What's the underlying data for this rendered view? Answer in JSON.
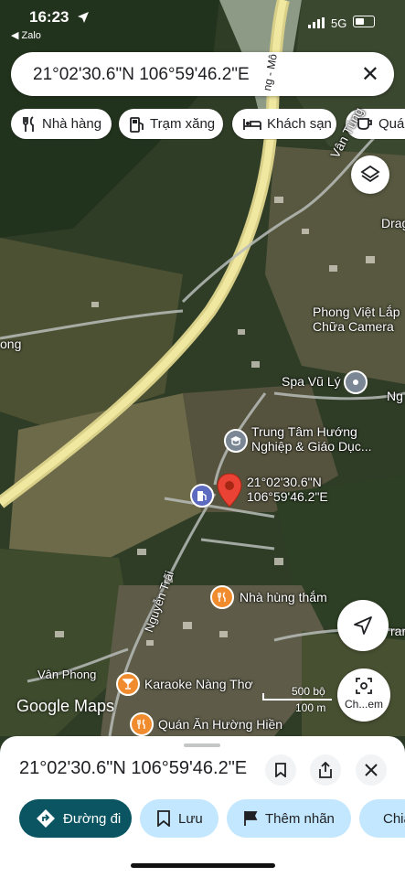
{
  "status_bar": {
    "time": "16:23",
    "back_app": "◀ Zalo",
    "network": "5G"
  },
  "search": {
    "query": "21°02'30.6\"N 106°59'46.2\"E",
    "clear_icon": "close-icon"
  },
  "chips": [
    {
      "label": "Nhà hàng",
      "icon": "restaurant-icon"
    },
    {
      "label": "Trạm xăng",
      "icon": "gas-station-icon"
    },
    {
      "label": "Khách sạn",
      "icon": "hotel-icon"
    },
    {
      "label": "Quán",
      "icon": "cafe-icon"
    }
  ],
  "map": {
    "labels": {
      "drag": "Drag",
      "van_tung": "Vân Tùng",
      "long": "ong",
      "ng": "Ng",
      "ram": "ram",
      "van_phong": "Vân Phong",
      "nguyen_trai": "Nguyễn Trãi",
      "mon": "ng - Mô"
    },
    "pois": {
      "phong_viet": "Phong Việt Lắp\nChữa Camera",
      "spa": "Spa Vũ Lý",
      "trung_tam": "Trung Tâm Hướng\nNghiệp & Giáo Dục...",
      "pin": "21°02'30.6\"N\n106°59'46.2\"E",
      "nha_hung_tham": "Nhà hùng thắm",
      "karaoke": "Karaoke Nàng Thơ",
      "quan_an": "Quán Ăn Hường Hiền"
    },
    "scale": {
      "feet": "500 bộ",
      "meters": "100 m"
    },
    "logo": "Google Maps",
    "lens_label": "Ch...em"
  },
  "sheet": {
    "title": "21°02'30.6\"N 106°59'46.2\"E",
    "actions": [
      {
        "label": "Đường đi",
        "icon": "directions-icon"
      },
      {
        "label": "Lưu",
        "icon": "bookmark-icon"
      },
      {
        "label": "Thêm nhãn",
        "icon": "flag-icon"
      },
      {
        "label": "Chia sẻ",
        "icon": "share-icon"
      }
    ]
  },
  "colors": {
    "accent": "#0b57d0",
    "primary_button": "#0b5563",
    "chip_tint": "#c3e7ff"
  }
}
